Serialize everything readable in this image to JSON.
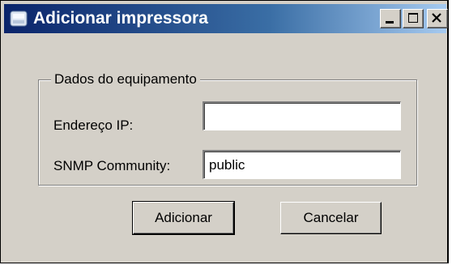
{
  "window": {
    "title": "Adicionar impressora",
    "controls": {
      "minimize_icon": "minimize-icon",
      "maximize_icon": "maximize-icon",
      "close_icon": "close-icon"
    },
    "app_icon": "printer-icon"
  },
  "group": {
    "legend": "Dados do equipamento",
    "fields": {
      "ip": {
        "label": "Endereço IP:",
        "value": ""
      },
      "snmp": {
        "label": "SNMP Community:",
        "value": "public"
      }
    }
  },
  "buttons": {
    "add": "Adicionar",
    "cancel": "Cancelar"
  },
  "colors": {
    "titlebar_start": "#0a246a",
    "titlebar_end": "#a6caf0",
    "face": "#d4d0c8"
  }
}
